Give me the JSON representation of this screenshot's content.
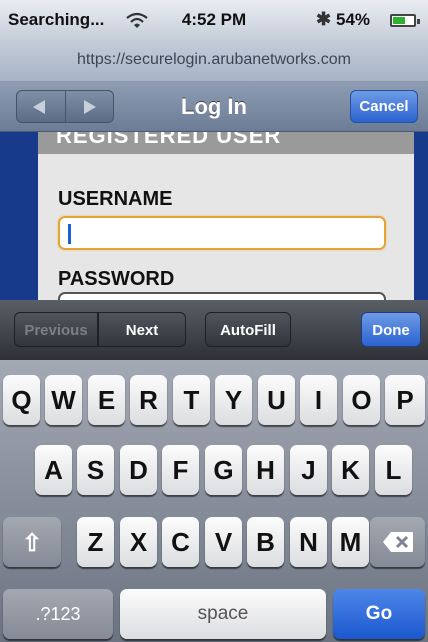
{
  "status_bar": {
    "carrier": "Searching...",
    "time": "4:52 PM",
    "battery": "54%",
    "icons": [
      "wifi-icon",
      "bluetooth-icon",
      "battery-icon"
    ],
    "battery_level": 0.54
  },
  "url_bar": {
    "url": "https://securelogin.arubanetworks.com"
  },
  "nav_bar": {
    "title": "Log In",
    "cancel_label": "Cancel",
    "icons": [
      "back-arrow-icon",
      "forward-arrow-icon"
    ]
  },
  "page": {
    "section_heading": "REGISTERED USER",
    "username_label": "USERNAME",
    "username_value": "",
    "password_label": "PASSWORD"
  },
  "form_assistant": {
    "previous": "Previous",
    "next": "Next",
    "autofill": "AutoFill",
    "done": "Done"
  },
  "keyboard": {
    "row1": [
      "Q",
      "W",
      "E",
      "R",
      "T",
      "Y",
      "U",
      "I",
      "O",
      "P"
    ],
    "row2": [
      "A",
      "S",
      "D",
      "F",
      "G",
      "H",
      "J",
      "K",
      "L"
    ],
    "row3": [
      "Z",
      "X",
      "C",
      "V",
      "B",
      "N",
      "M"
    ],
    "numbers_key": ".?123",
    "space_key": "space",
    "go_key": "Go",
    "icons": [
      "shift-icon",
      "backspace-icon"
    ]
  },
  "colors": {
    "accent_blue": "#2b63d0",
    "page_background": "#173a8a",
    "focus_border": "#e4a43a"
  }
}
